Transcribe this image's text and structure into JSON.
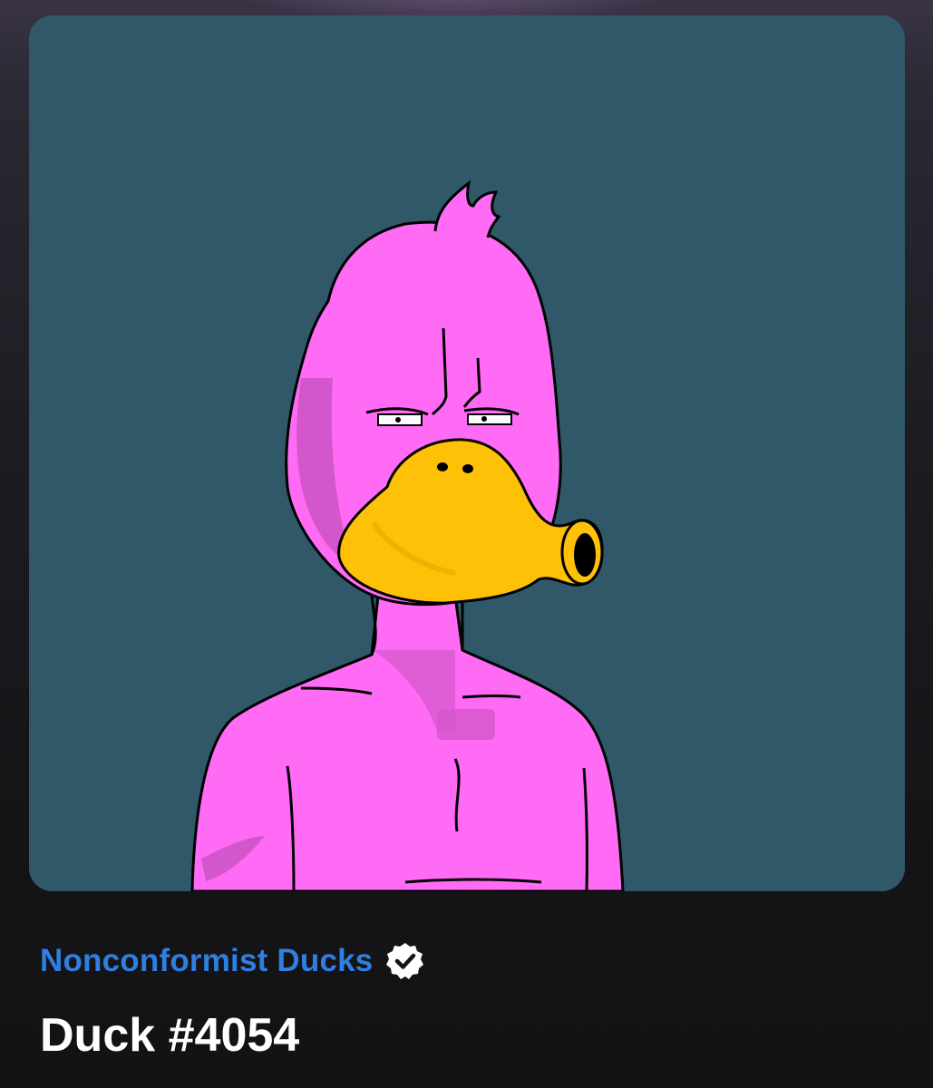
{
  "item": {
    "collection_name": "Nonconformist Ducks",
    "collection_verified_icon": "verified-badge-icon",
    "title": "Duck #4054"
  },
  "artwork": {
    "subject": "duck-artwork",
    "background_color": "#305868",
    "body_color": "#ff6bf5",
    "beak_color": "#ffc107"
  },
  "colors": {
    "page_background": "#131315",
    "collection_link": "#2f7fe0",
    "title_text": "#ffffff"
  }
}
